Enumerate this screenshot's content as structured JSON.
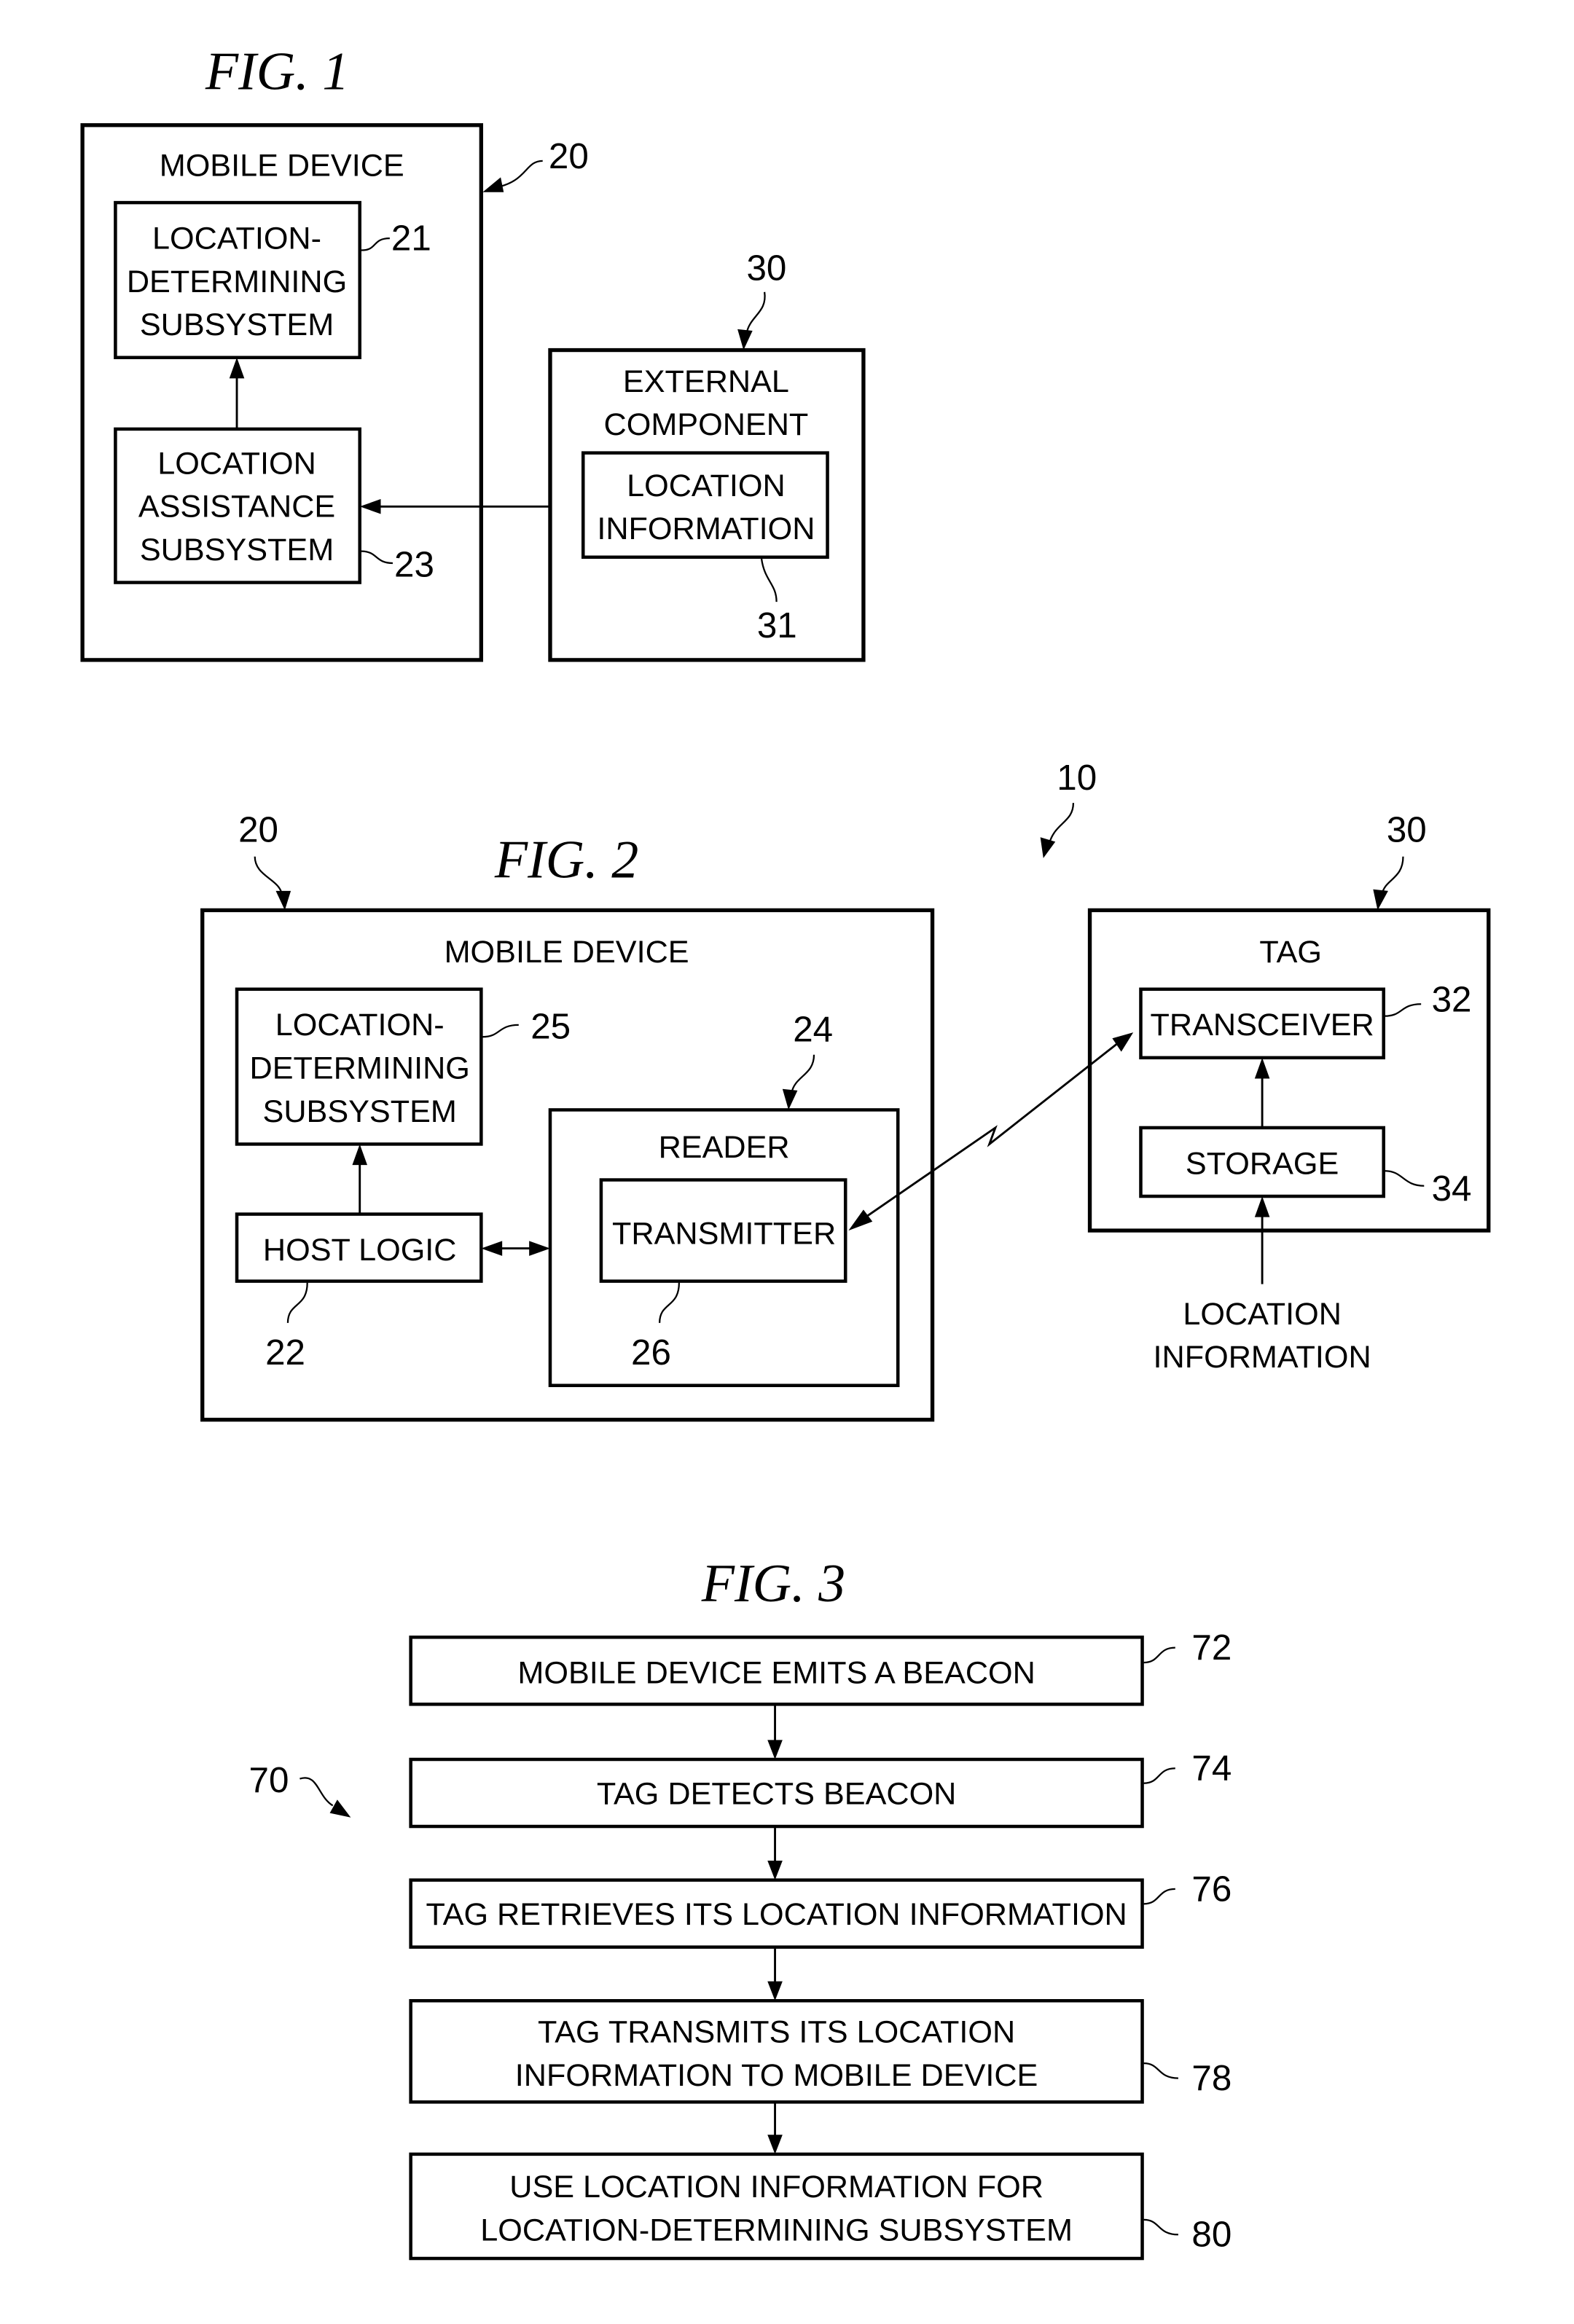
{
  "fig1": {
    "title": "FIG. 1",
    "mobile_device": {
      "label": "MOBILE DEVICE",
      "ref": "20"
    },
    "location_determining": {
      "lines": [
        "LOCATION-",
        "DETERMINING",
        "SUBSYSTEM"
      ],
      "ref": "21"
    },
    "location_assistance": {
      "lines": [
        "LOCATION",
        "ASSISTANCE",
        "SUBSYSTEM"
      ],
      "ref": "23"
    },
    "external_component": {
      "lines": [
        "EXTERNAL",
        "COMPONENT"
      ],
      "ref": "30"
    },
    "location_information": {
      "lines": [
        "LOCATION",
        "INFORMATION"
      ],
      "ref": "31"
    }
  },
  "fig2": {
    "title": "FIG. 2",
    "system_ref": "10",
    "mobile_device": {
      "label": "MOBILE DEVICE",
      "ref": "20"
    },
    "location_determining": {
      "lines": [
        "LOCATION-",
        "DETERMINING",
        "SUBSYSTEM"
      ],
      "ref": "25"
    },
    "host_logic": {
      "label": "HOST LOGIC",
      "ref": "22"
    },
    "reader": {
      "label": "READER",
      "ref": "24"
    },
    "transmitter": {
      "label": "TRANSMITTER",
      "ref": "26"
    },
    "tag": {
      "label": "TAG",
      "ref": "30"
    },
    "transceiver": {
      "label": "TRANSCEIVER",
      "ref": "32"
    },
    "storage": {
      "label": "STORAGE",
      "ref": "34"
    },
    "location_input": {
      "lines": [
        "LOCATION",
        "INFORMATION"
      ]
    }
  },
  "fig3": {
    "title": "FIG. 3",
    "flow_ref": "70",
    "steps": [
      {
        "lines": [
          "MOBILE DEVICE EMITS A BEACON"
        ],
        "ref": "72"
      },
      {
        "lines": [
          "TAG DETECTS BEACON"
        ],
        "ref": "74"
      },
      {
        "lines": [
          "TAG RETRIEVES ITS LOCATION INFORMATION"
        ],
        "ref": "76"
      },
      {
        "lines": [
          "TAG TRANSMITS ITS LOCATION",
          "INFORMATION TO MOBILE DEVICE"
        ],
        "ref": "78"
      },
      {
        "lines": [
          "USE LOCATION INFORMATION FOR",
          "LOCATION-DETERMINING SUBSYSTEM"
        ],
        "ref": "80"
      }
    ]
  }
}
